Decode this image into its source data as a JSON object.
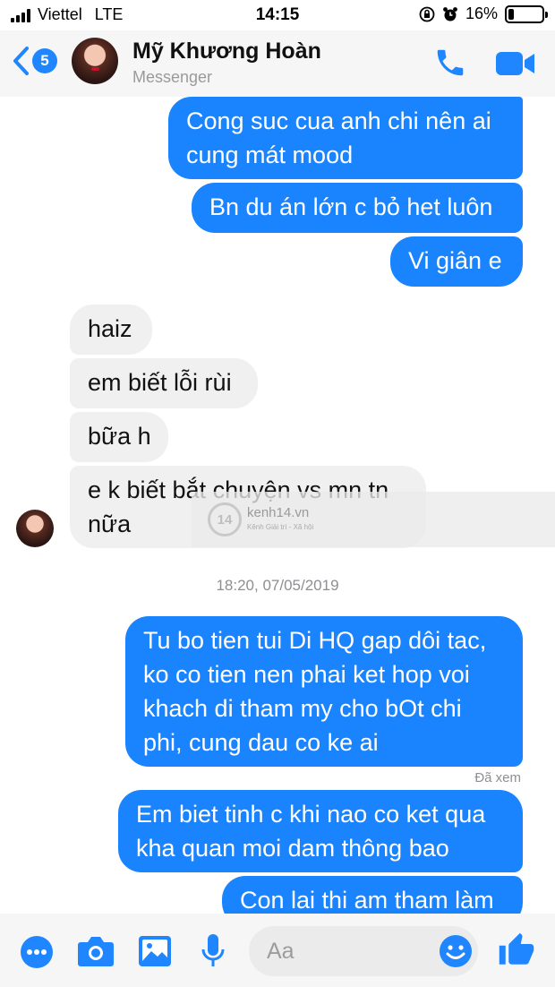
{
  "status_bar": {
    "carrier": "Viettel",
    "network": "LTE",
    "time": "14:15",
    "battery_percent": "16%",
    "battery_level": 0.16
  },
  "header": {
    "back_badge": "5",
    "contact_name": "Mỹ Khương Hoàn",
    "contact_subtitle": "Messenger",
    "icons": [
      "back-chevron-icon",
      "phone-icon",
      "video-camera-icon"
    ]
  },
  "messages": {
    "out_1": [
      "Cong suc cua anh chi nên ai",
      "cung mát mood"
    ],
    "out_2": "Bn du án lớn c bỏ het luôn",
    "out_3": "Vi giân e",
    "in_1": "haiz",
    "in_2": "em biết lỗi rùi",
    "in_3": "bữa h",
    "in_4": [
      "e k biết bắt chuyện vs mn tn",
      "nữa"
    ],
    "timestamp": "18:20, 07/05/2019",
    "out_4": [
      "Tu bo tien tui Di HQ gap dôi tac,",
      "ko co tien nen phai ket hop voi",
      "khach di tham my cho bOt chi",
      "phi, cung dau co ke ai"
    ],
    "seen_label": "Đã xem",
    "out_5": [
      "Em biet tinh c khi nao co ket qua",
      "kha quan moi dam thông bao"
    ],
    "out_6": "Con lai thi am tham làm"
  },
  "watermark": {
    "logo_text": "14",
    "name": "kenh14.vn",
    "tagline": "Kênh Giải trí - Xã hội"
  },
  "composer": {
    "placeholder": "Aa",
    "icons": [
      "more-icon",
      "camera-icon",
      "gallery-icon",
      "microphone-icon",
      "emoji-icon",
      "thumbs-up-icon"
    ]
  },
  "colors": {
    "accent": "#1a84ff",
    "incoming_bubble": "#f0f0f0",
    "bar_background": "#f6f6f7"
  }
}
